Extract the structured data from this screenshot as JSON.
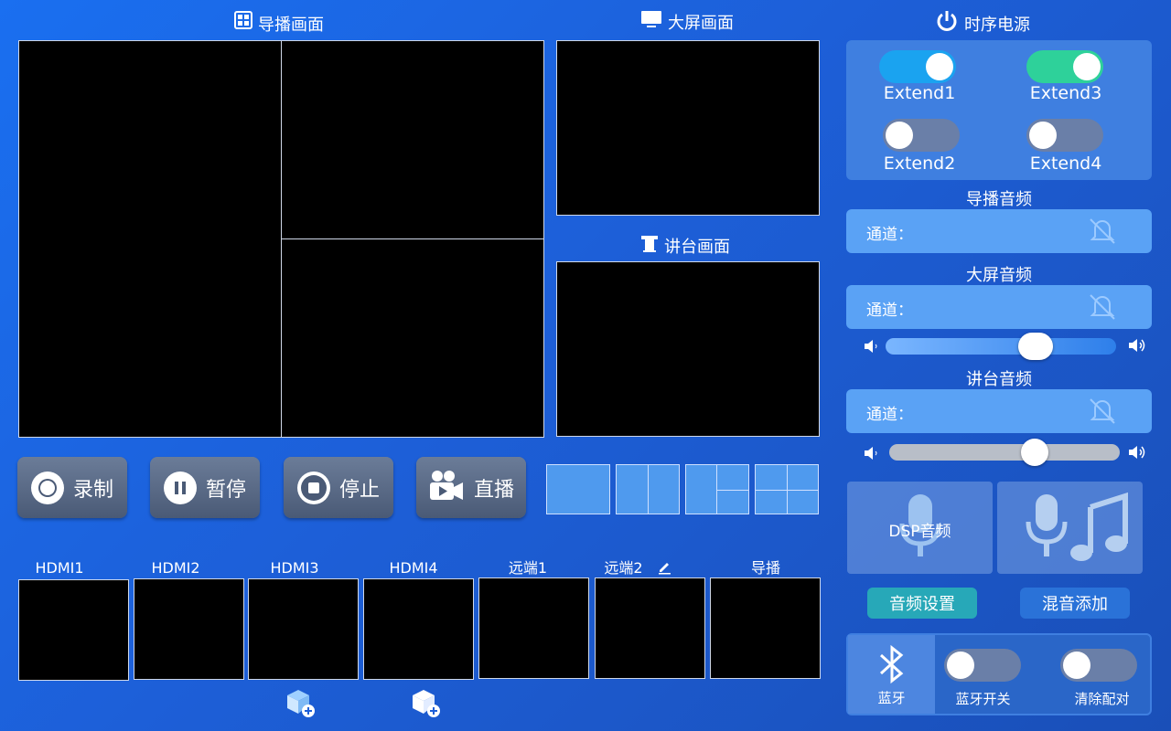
{
  "sections": {
    "director": "导播画面",
    "bigscreen": "大屏画面",
    "podium": "讲台画面",
    "power": "时序电源"
  },
  "buttons": {
    "record": "录制",
    "pause": "暂停",
    "stop": "停止",
    "live": "直播"
  },
  "sources": [
    "HDMI1",
    "HDMI2",
    "HDMI3",
    "HDMI4",
    "远端1",
    "远端2",
    "导播"
  ],
  "power": {
    "extend1": {
      "label": "Extend1",
      "on": true,
      "color": "#1aa3f0"
    },
    "extend2": {
      "label": "Extend2",
      "on": false
    },
    "extend3": {
      "label": "Extend3",
      "on": true,
      "color": "#2ed19a"
    },
    "extend4": {
      "label": "Extend4",
      "on": false
    }
  },
  "audio": {
    "director_title": "导播音频",
    "bigscreen_title": "大屏音频",
    "podium_title": "讲台音频",
    "channel_label": "通道：",
    "bigscreen_volume": 0.65,
    "podium_volume": 0.63
  },
  "dsp": {
    "label": "DSP音频",
    "settings": "音频设置",
    "mix_add": "混音添加"
  },
  "bluetooth": {
    "label": "蓝牙",
    "switch": "蓝牙开关",
    "clear": "清除配对"
  },
  "icons": {
    "director": "grid-icon",
    "bigscreen": "monitor-icon",
    "podium": "podium-icon",
    "power": "power-icon"
  }
}
